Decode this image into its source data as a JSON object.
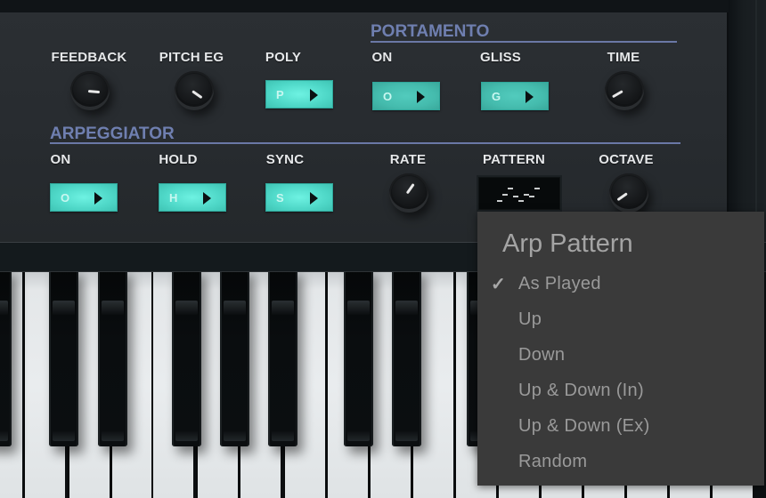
{
  "portamento": {
    "title": "PORTAMENTO",
    "controls": [
      {
        "label": "ON",
        "type": "toggle",
        "letter": "O",
        "state": "off"
      },
      {
        "label": "GLISS",
        "type": "toggle",
        "letter": "G",
        "state": "off"
      },
      {
        "label": "TIME",
        "type": "knob"
      }
    ]
  },
  "top_row": {
    "feedback": {
      "label": "FEEDBACK",
      "type": "knob"
    },
    "pitch_eg": {
      "label": "PITCH EG",
      "type": "knob"
    },
    "poly": {
      "label": "POLY",
      "type": "toggle",
      "letter": "P",
      "state": "on"
    }
  },
  "arpeggiator": {
    "title": "ARPEGGIATOR",
    "on": {
      "label": "ON",
      "letter": "O",
      "state": "on"
    },
    "hold": {
      "label": "HOLD",
      "letter": "H",
      "state": "on"
    },
    "sync": {
      "label": "SYNC",
      "letter": "S",
      "state": "on"
    },
    "rate": {
      "label": "RATE",
      "type": "knob"
    },
    "pattern": {
      "label": "PATTERN",
      "type": "display"
    },
    "octave": {
      "label": "OCTAVE",
      "type": "knob"
    }
  },
  "colors": {
    "toggle_on": "#5fe8d8",
    "toggle_off": "#48c2b4",
    "section_title": "#6f7fb0",
    "menu_bg": "#3a3a3a"
  },
  "icons": {
    "toggle_arrow": "play-triangle-icon",
    "checkmark": "✓"
  },
  "arp_pattern_menu": {
    "title": "Arp Pattern",
    "selected": "As Played",
    "items": [
      {
        "label": "As Played",
        "checked": true
      },
      {
        "label": "Up",
        "checked": false
      },
      {
        "label": "Down",
        "checked": false
      },
      {
        "label": "Up & Down (In)",
        "checked": false
      },
      {
        "label": "Up & Down (Ex)",
        "checked": false
      },
      {
        "label": "Random",
        "checked": false
      }
    ]
  }
}
